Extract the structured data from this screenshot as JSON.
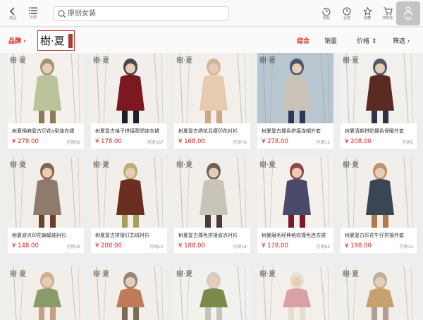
{
  "topbar": {
    "back_label": "返回",
    "category_label": "分类",
    "search_placeholder": "原创女装",
    "actions": [
      {
        "label": "轻松",
        "icon": "history-icon"
      },
      {
        "label": "足迹",
        "icon": "clock-icon"
      },
      {
        "label": "收藏",
        "icon": "star-icon"
      },
      {
        "label": "购物车",
        "icon": "cart-icon"
      }
    ],
    "user_label": "我的"
  },
  "filter": {
    "brand_label": "品牌 ›",
    "brand_logo": "樹·夏",
    "sorts": [
      {
        "label": "综合",
        "active": true
      },
      {
        "label": "销量",
        "active": false
      },
      {
        "label": "价格 ⇕",
        "active": false
      },
      {
        "label": "筛选 ›",
        "active": false
      }
    ]
  },
  "products": [
    {
      "title": "树夏棉麻复古印花a型连衣裙",
      "price": "¥ 278.00",
      "sales": "月销36",
      "colors": [
        "#f4f1ec",
        "#b9c49a",
        "#8e7a55"
      ]
    },
    {
      "title": "树夏复古格子拼接圆领连衣裙",
      "price": "¥ 178.00",
      "sales": "月销367",
      "colors": [
        "#f2efea",
        "#7b1820",
        "#1d1d2b"
      ]
    },
    {
      "title": "树夏复古绣花显瘦印花衬衫",
      "price": "¥ 168.00",
      "sales": "月销78",
      "colors": [
        "#f3f0eb",
        "#e6cbb0",
        "#c8a888"
      ]
    },
    {
      "title": "树夏复古撞色拼接连帽外套",
      "price": "¥ 278.00",
      "sales": "月销11",
      "colors": [
        "#b8c6cf",
        "#c9c2b6",
        "#2e3a54"
      ]
    },
    {
      "title": "树夏清新拼贴撞色保暖外套",
      "price": "¥ 208.00",
      "sales": "月销5",
      "colors": [
        "#f2f0ec",
        "#5b2a22",
        "#2d3548"
      ]
    },
    {
      "title": "树夏波点印花蝙蝠袖衬衫",
      "price": "¥ 148.00",
      "sales": "月销38",
      "colors": [
        "#f1eee9",
        "#8e7b6c",
        "#6d3f2c"
      ]
    },
    {
      "title": "树夏复古拼接灯芯绒衬衫",
      "price": "¥ 208.00",
      "sales": "月销21",
      "colors": [
        "#f2efea",
        "#6b2f22",
        "#a8a05a"
      ]
    },
    {
      "title": "树夏复古撞色拼接波点衬衫",
      "price": "¥ 188.00",
      "sales": "月销18",
      "colors": [
        "#f2efea",
        "#c9c4b9",
        "#4a3c3a"
      ]
    },
    {
      "title": "树夏磨毛经典格纹撞色连衣裙",
      "price": "¥ 178.00",
      "sales": "月销83",
      "colors": [
        "#f4f1ec",
        "#4a4a6a",
        "#7d1a2a"
      ]
    },
    {
      "title": "树夏复古印花牛仔拼接外套",
      "price": "¥ 198.00",
      "sales": "月销14",
      "colors": [
        "#f2efea",
        "#3b4654",
        "#b07a4a"
      ]
    },
    {
      "title": "",
      "price": "",
      "sales": "",
      "colors": [
        "#f2efea",
        "#8a9a6a",
        "#c4a080"
      ]
    },
    {
      "title": "",
      "price": "",
      "sales": "",
      "colors": [
        "#f2efea",
        "#c07a5a",
        "#7a6a5a"
      ]
    },
    {
      "title": "",
      "price": "",
      "sales": "",
      "colors": [
        "#f1f1ee",
        "#7a8a4a",
        "#c9c4b9"
      ]
    },
    {
      "title": "",
      "price": "",
      "sales": "",
      "colors": [
        "#f3f0ec",
        "#d9a0a8",
        "#e6dcd0"
      ]
    },
    {
      "title": "",
      "price": "",
      "sales": "",
      "colors": [
        "#f2efea",
        "#c8a070",
        "#b0a090"
      ]
    }
  ],
  "colors": {
    "accent": "#e0231b",
    "background": "#eeeeee"
  }
}
